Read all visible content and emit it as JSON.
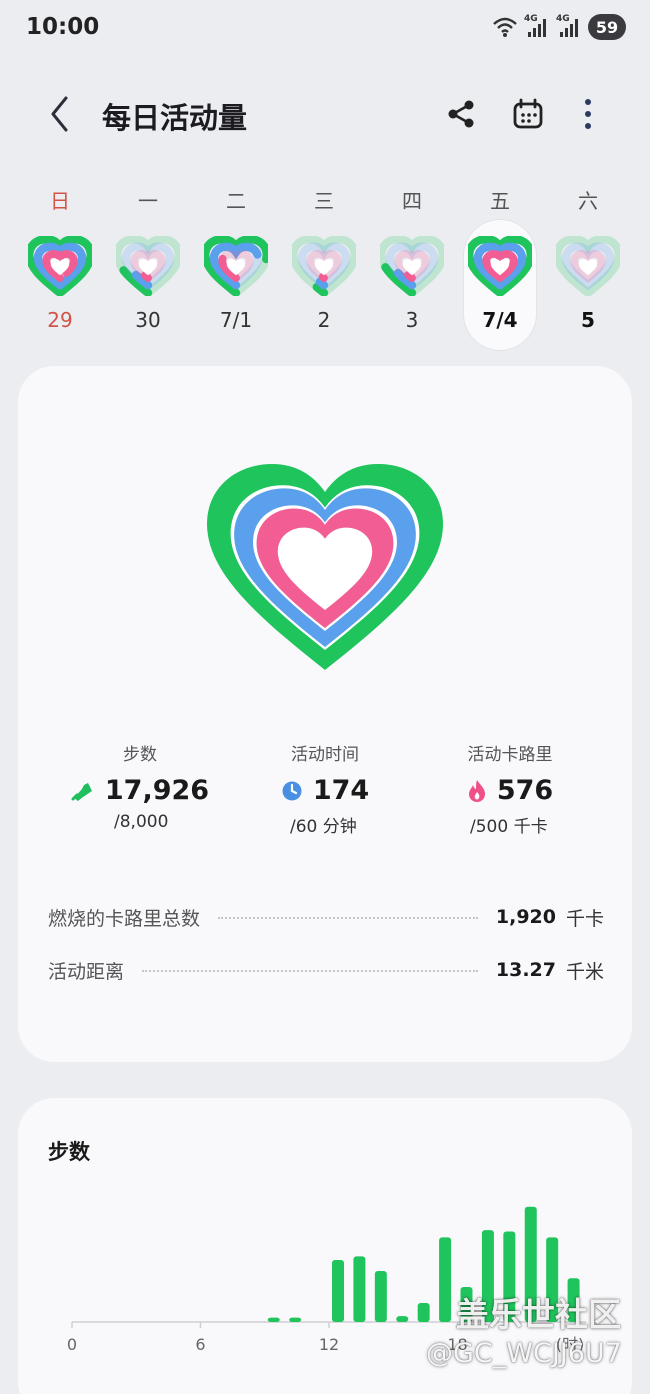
{
  "status_bar": {
    "time": "10:00",
    "signal_1": "4G",
    "signal_2": "4G",
    "battery": "59"
  },
  "header": {
    "title": "每日活动量",
    "icons": [
      "back-icon",
      "share-icon",
      "calendar-icon",
      "more-vert-icon"
    ]
  },
  "week": [
    {
      "weekday": "日",
      "date": "29",
      "sunday": true,
      "selected": false,
      "bold": false,
      "rings": {
        "move": 1.0,
        "time": 1.0,
        "cal": 0.9
      }
    },
    {
      "weekday": "一",
      "date": "30",
      "sunday": false,
      "selected": false,
      "bold": false,
      "rings": {
        "move": 0.18,
        "time": 0.12,
        "cal": 0.05
      }
    },
    {
      "weekday": "二",
      "date": "7/1",
      "sunday": false,
      "selected": false,
      "bold": false,
      "rings": {
        "move": 0.75,
        "time": 0.7,
        "cal": 0.3
      }
    },
    {
      "weekday": "三",
      "date": "2",
      "sunday": false,
      "selected": false,
      "bold": false,
      "rings": {
        "move": 0.05,
        "time": 0.04,
        "cal": 0.02
      }
    },
    {
      "weekday": "四",
      "date": "3",
      "sunday": false,
      "selected": false,
      "bold": false,
      "rings": {
        "move": 0.2,
        "time": 0.14,
        "cal": 0.06
      }
    },
    {
      "weekday": "五",
      "date": "7/4",
      "sunday": false,
      "selected": true,
      "bold": true,
      "rings": {
        "move": 1.0,
        "time": 1.0,
        "cal": 1.0
      }
    },
    {
      "weekday": "六",
      "date": "5",
      "sunday": false,
      "selected": false,
      "bold": true,
      "rings": {
        "move": 0.0,
        "time": 0.0,
        "cal": 0.0
      }
    }
  ],
  "metrics": [
    {
      "label": "步数",
      "value": "17,926",
      "goal": "/8,000",
      "icon": "shoe-icon",
      "color": "#1fbf5e",
      "progress": 1.0
    },
    {
      "label": "活动时间",
      "value": "174",
      "goal": "/60 分钟",
      "icon": "clock-icon",
      "color": "#4a90e2",
      "progress": 1.0
    },
    {
      "label": "活动卡路里",
      "value": "576",
      "goal": "/500 千卡",
      "icon": "flame-icon",
      "color": "#f0508a",
      "progress": 1.0
    }
  ],
  "stats": [
    {
      "label": "燃烧的卡路里总数",
      "value": "1,920",
      "unit": "千卡"
    },
    {
      "label": "活动距离",
      "value": "13.27",
      "unit": "千米"
    }
  ],
  "colors": {
    "move_ring": "#1fc45c",
    "time_ring": "#5aa0ec",
    "cal_ring": "#f25d94",
    "sunday_red": "#d25448"
  },
  "steps_section": {
    "title": "步数",
    "chart_data": {
      "type": "bar",
      "x_ticks": [
        "0",
        "6",
        "12",
        "18"
      ],
      "x_unit": "(时)",
      "xlim": [
        0,
        24
      ],
      "x": [
        9,
        10,
        12,
        13,
        14,
        15,
        16,
        17,
        18,
        19,
        20,
        21,
        22,
        23
      ],
      "values": [
        60,
        60,
        850,
        900,
        700,
        80,
        260,
        1160,
        480,
        1260,
        1240,
        1580,
        1160,
        600
      ],
      "ylim": [
        0,
        1700
      ],
      "grid": false
    }
  },
  "watermark": {
    "main": "盖乐世社区",
    "sub": "@GC_WCJJ6U7"
  }
}
